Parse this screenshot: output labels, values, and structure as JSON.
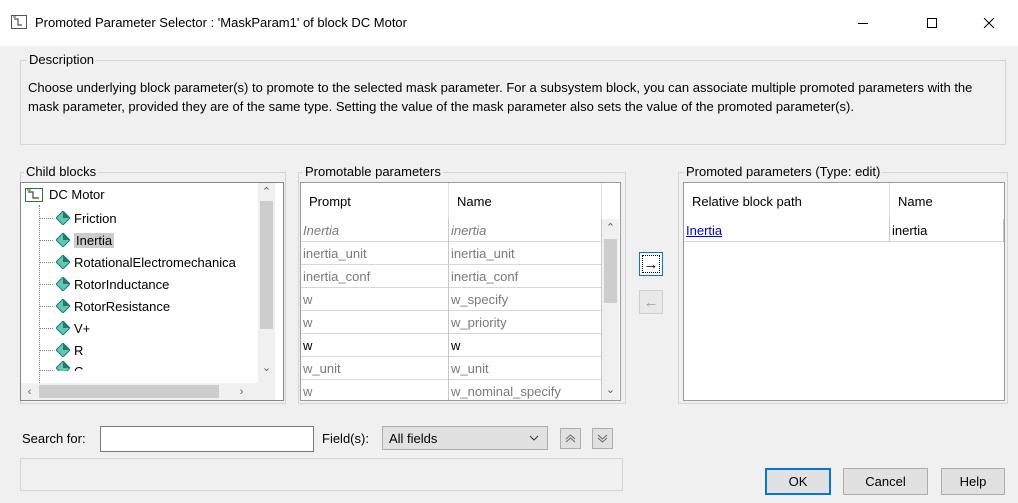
{
  "window": {
    "title": "Promoted Parameter Selector : 'MaskParam1' of block DC Motor"
  },
  "description": {
    "legend": "Description",
    "text": "Choose underlying block parameter(s) to promote to the selected mask parameter. For a subsystem block, you can associate multiple promoted parameters with the mask parameter, provided they are of the same type. Setting the value of the mask parameter also sets the value of the promoted parameter(s)."
  },
  "child_blocks": {
    "legend": "Child blocks",
    "root": "DC Motor",
    "items": [
      {
        "label": "Friction"
      },
      {
        "label": "Inertia"
      },
      {
        "label": "RotationalElectromechanica"
      },
      {
        "label": "RotorInductance"
      },
      {
        "label": "RotorResistance"
      },
      {
        "label": "V+"
      },
      {
        "label": "R"
      },
      {
        "label": "C"
      }
    ],
    "selected": "Inertia"
  },
  "promotable": {
    "legend": "Promotable parameters",
    "columns": [
      "Prompt",
      "Name"
    ],
    "rows": [
      {
        "prompt": "Inertia",
        "name": "inertia"
      },
      {
        "prompt": "inertia_unit",
        "name": "inertia_unit"
      },
      {
        "prompt": "inertia_conf",
        "name": "inertia_conf"
      },
      {
        "prompt": "w",
        "name": "w_specify"
      },
      {
        "prompt": "w",
        "name": "w_priority"
      },
      {
        "prompt": "w",
        "name": "w"
      },
      {
        "prompt": "w_unit",
        "name": "w_unit"
      },
      {
        "prompt": "w",
        "name": "w_nominal_specify"
      }
    ]
  },
  "promoted": {
    "legend": "Promoted parameters (Type: edit)",
    "columns": [
      "Relative block path",
      "Name"
    ],
    "rows": [
      {
        "path": "Inertia",
        "name": "inertia"
      }
    ]
  },
  "transfer": {
    "add_glyph": "→",
    "remove_glyph": "←"
  },
  "search": {
    "label": "Search for:",
    "value": "",
    "fields_label": "Field(s):",
    "fields_value": "All fields"
  },
  "buttons": {
    "ok": "OK",
    "cancel": "Cancel",
    "help": "Help"
  },
  "colors": {
    "selection": "#cccccc",
    "link": "#0000ee",
    "focus": "#0078d7",
    "diamond_light": "#5fc9b0",
    "diamond_dark": "#1e7b73"
  }
}
